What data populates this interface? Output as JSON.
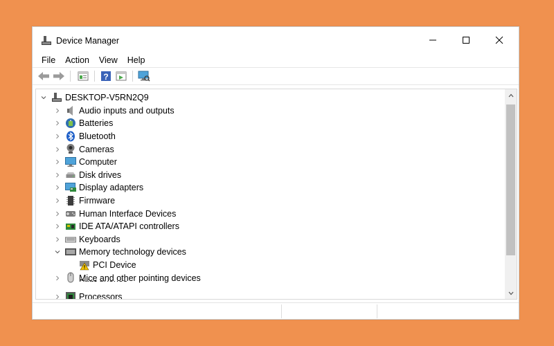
{
  "window": {
    "title": "Device Manager"
  },
  "menu": {
    "items": [
      {
        "label": "File"
      },
      {
        "label": "Action"
      },
      {
        "label": "View"
      },
      {
        "label": "Help"
      }
    ]
  },
  "toolbar": {
    "buttons": [
      "back-icon",
      "forward-icon",
      "properties-icon",
      "help-icon",
      "update-driver-icon",
      "scan-hardware-icon"
    ]
  },
  "tree": {
    "root": {
      "label": "DESKTOP-V5RN2Q9",
      "expanded": true
    },
    "items": [
      {
        "label": "Audio inputs and outputs",
        "icon": "speaker-icon",
        "expanded": false
      },
      {
        "label": "Batteries",
        "icon": "battery-icon",
        "expanded": false
      },
      {
        "label": "Bluetooth",
        "icon": "bluetooth-icon",
        "expanded": false
      },
      {
        "label": "Cameras",
        "icon": "camera-icon",
        "expanded": false
      },
      {
        "label": "Computer",
        "icon": "monitor-icon",
        "expanded": false
      },
      {
        "label": "Disk drives",
        "icon": "disk-drive-icon",
        "expanded": false
      },
      {
        "label": "Display adapters",
        "icon": "display-adapter-icon",
        "expanded": false
      },
      {
        "label": "Firmware",
        "icon": "firmware-chip-icon",
        "expanded": false
      },
      {
        "label": "Human Interface Devices",
        "icon": "hid-icon",
        "expanded": false
      },
      {
        "label": "IDE ATA/ATAPI controllers",
        "icon": "ide-controller-icon",
        "expanded": false
      },
      {
        "label": "Keyboards",
        "icon": "keyboard-icon",
        "expanded": false
      },
      {
        "label": "Memory technology devices",
        "icon": "memory-device-icon",
        "expanded": true
      },
      {
        "label": "PCI Device",
        "icon": "warning-device-icon",
        "child": true,
        "status": "warning"
      },
      {
        "label": "Mice and other pointing devices",
        "icon": "mouse-icon",
        "expanded": false
      },
      {
        "label": "Processors",
        "icon": "processor-icon",
        "expanded": false
      }
    ],
    "overlap_text": "Print queues"
  },
  "colors": {
    "background": "#f0914f",
    "warning": "#f2c200",
    "scroll_thumb": "#c1c1c1"
  }
}
